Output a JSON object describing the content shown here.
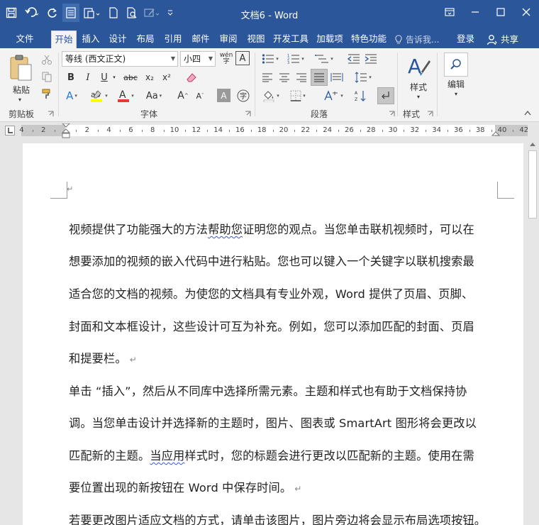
{
  "window": {
    "title": "文档6 - Word"
  },
  "tabs": {
    "file": "文件",
    "items": [
      "开始",
      "插入",
      "设计",
      "布局",
      "引用",
      "邮件",
      "审阅",
      "视图",
      "开发工具",
      "加载项",
      "特色功能"
    ],
    "tell_me": "告诉我...",
    "login": "登录",
    "share": "共享"
  },
  "ribbon": {
    "clipboard": {
      "label": "剪贴板",
      "paste": "粘贴"
    },
    "font": {
      "label": "字体",
      "font_name": "等线 (西文正文)",
      "font_size": "小四",
      "wen": "wén",
      "A": "A",
      "bold": "B",
      "italic": "I",
      "underline": "U",
      "strike": "abc",
      "sub": "x₂",
      "sup": "x²",
      "aa": "Aa",
      "grow": "A",
      "shrink": "A",
      "char_border": "A",
      "enclose": "字"
    },
    "paragraph": {
      "label": "段落"
    },
    "styles": {
      "label": "样式",
      "button": "样式"
    },
    "editing": {
      "button": "编辑"
    }
  },
  "ruler": {
    "labels": [
      "4",
      "2",
      "2",
      "4",
      "6",
      "8",
      "10",
      "12",
      "14",
      "16",
      "18",
      "20",
      "22",
      "24",
      "26",
      "28",
      "30",
      "32",
      "34",
      "36",
      "38",
      "40",
      "42"
    ]
  },
  "document": {
    "lines": [
      "视频提供了功能强大的方法帮助您证明您的观点。当您单击联机视频时，可以在",
      "想要添加的视频的嵌入代码中进行粘贴。您也可以键入一个关键字以联机搜索最",
      "适合您的文档的视频。为使您的文档具有专业外观，Word 提供了页眉、页脚、",
      "封面和文本框设计，这些设计可互为补充。例如，您可以添加匹配的封面、页眉",
      "和提要栏。",
      "单击 “插入”，然后从不同库中选择所需元素。主题和样式也有助于文档保持协",
      "调。当您单击设计并选择新的主题时，图片、图表或 SmartArt 图形将会更改以",
      "匹配新的主题。当应用样式时，您的标题会进行更改以匹配新的主题。使用在需",
      "要位置出现的新按钮在 Word 中保存时间。",
      "若要更改图片适应文档的方式，请单击该图片，图片旁边将会显示布局选项按钮。"
    ],
    "paragraph_mark": "↵"
  }
}
